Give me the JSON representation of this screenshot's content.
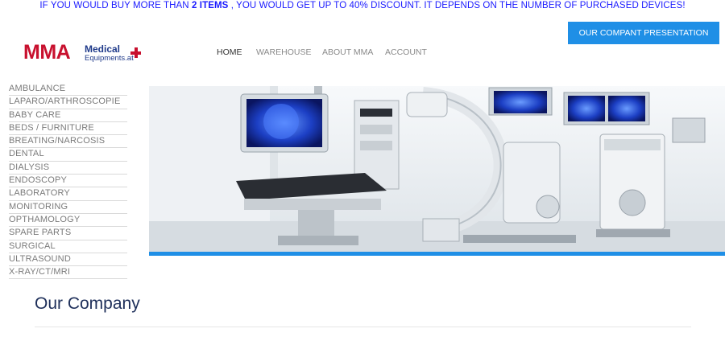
{
  "promo": {
    "text_before": "IF YOU WOULD BUY MORE THAN ",
    "text_bold": "2 ITEMS",
    "text_after": " , YOU WOULD GET UP TO 40% DISCOUNT. IT DEPENDS ON THE NUMBER OF PURCHASED DEVICES!"
  },
  "logo": {
    "brand": "MMA",
    "line1": "Medical",
    "line2": "Equipments.at"
  },
  "nav": [
    "HOME",
    "WAREHOUSE",
    "ABOUT MMA",
    "ACCOUNT"
  ],
  "presentation_button": "OUR COMPANT PRESENTATION",
  "categories": [
    "AMBULANCE",
    "LAPARO/ARTHROSCOPIE",
    "BABY CARE",
    "BEDS / FURNITURE",
    "BREATING/NARCOSIS",
    "DENTAL",
    "DIALYSIS",
    "ENDOSCOPY",
    "LABORATORY",
    "MONITORING",
    "OPTHAMOLOGY",
    "SPARE PARTS",
    "SURGICAL",
    "ULTRASOUND",
    "X-RAY/CT/MRI"
  ],
  "section": {
    "heading": "Our Company"
  },
  "colors": {
    "promo": "#1a1aff",
    "brand_red": "#c8102e",
    "accent_blue": "#1f8fe6",
    "heading": "#1e2f5a"
  },
  "hero": {
    "image": "operating-room-equipment"
  }
}
